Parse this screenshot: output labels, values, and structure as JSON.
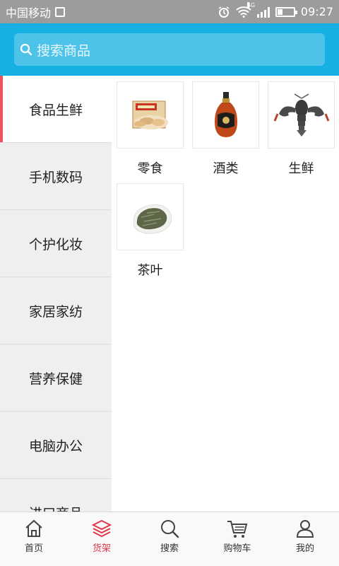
{
  "status_bar": {
    "carrier": "中国移动",
    "network": "4G",
    "time": "09:27",
    "battery_level": 0.3
  },
  "search": {
    "placeholder": "搜索商品"
  },
  "sidebar": {
    "items": [
      {
        "label": "食品生鲜",
        "active": true
      },
      {
        "label": "手机数码"
      },
      {
        "label": "个护化妆"
      },
      {
        "label": "家居家纺"
      },
      {
        "label": "营养保健"
      },
      {
        "label": "电脑办公"
      },
      {
        "label": "进口商品"
      }
    ]
  },
  "products": [
    {
      "label": "零食",
      "icon": "snack-box-image"
    },
    {
      "label": "酒类",
      "icon": "cognac-bottle-image"
    },
    {
      "label": "生鲜",
      "icon": "lobster-image"
    },
    {
      "label": "茶叶",
      "icon": "tea-leaves-image"
    }
  ],
  "tabbar": {
    "items": [
      {
        "label": "首页",
        "icon": "home-icon"
      },
      {
        "label": "货架",
        "icon": "layers-icon",
        "active": true
      },
      {
        "label": "搜索",
        "icon": "search-icon"
      },
      {
        "label": "购物车",
        "icon": "cart-icon"
      },
      {
        "label": "我的",
        "icon": "user-icon"
      }
    ]
  },
  "colors": {
    "accent": "#16b0e3",
    "active_tab": "#e0364a",
    "active_marker": "#f0525d"
  }
}
